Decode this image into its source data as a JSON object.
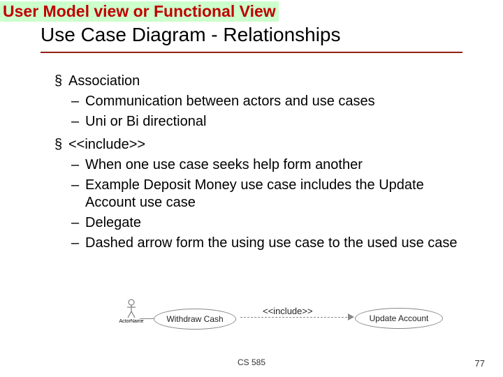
{
  "banner": "User Model view or Functional View",
  "title": "Use Case Diagram - Relationships",
  "bullets": {
    "b1": "Association",
    "b1a": "Communication between actors and use cases",
    "b1b": "Uni or Bi directional",
    "b2": "<<include>>",
    "b2a": "When one use case seeks help form another",
    "b2b": "Example Deposit Money use case includes the Update Account use case",
    "b2c": "Delegate",
    "b2d": "Dashed arrow form the using use case to the used use case"
  },
  "diagram": {
    "actor_label": "ActorName",
    "uc1": "Withdraw Cash",
    "uc2": "Update Account",
    "link_label": "<<include>>"
  },
  "footer": {
    "course": "CS 585",
    "page": "77"
  }
}
